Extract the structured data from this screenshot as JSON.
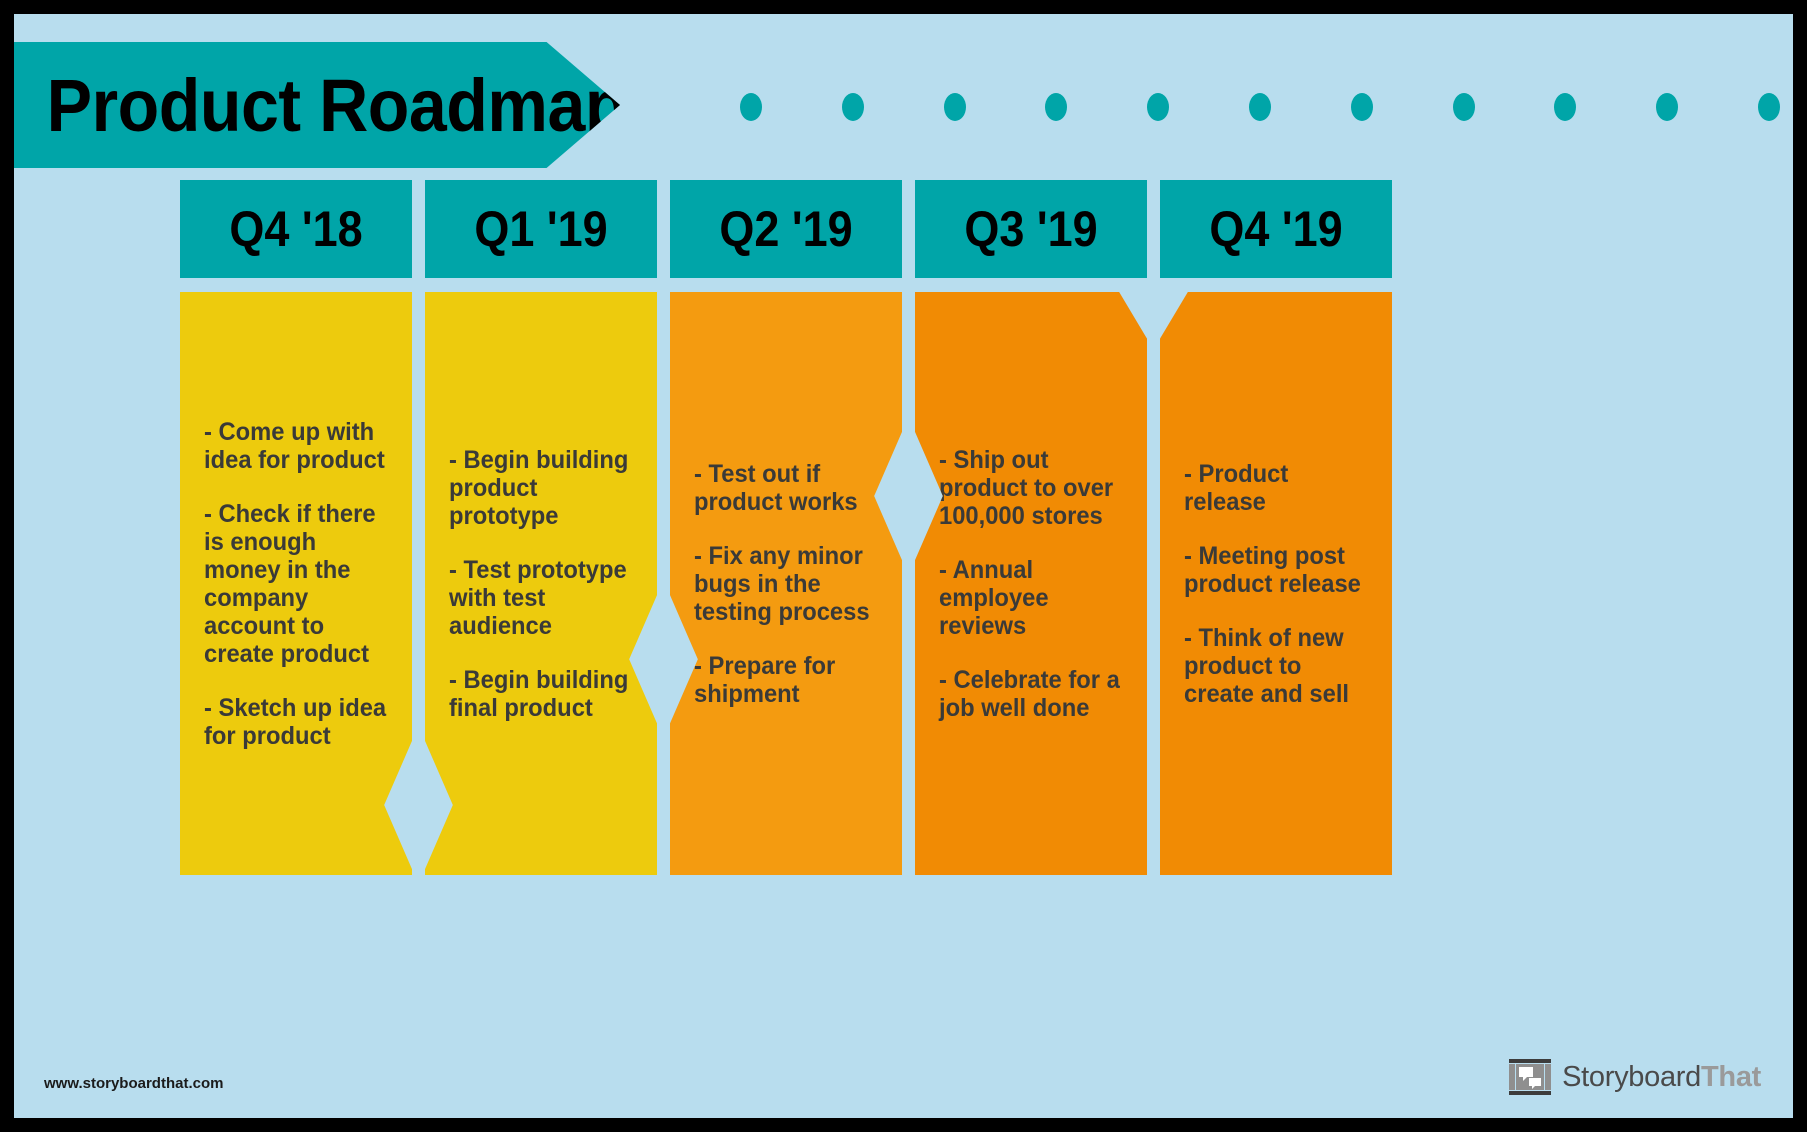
{
  "poster": {
    "title": "Product Roadmap",
    "background_color": "#b8ddee",
    "frame_color": "#000000",
    "accent_teal": "#00a5a8",
    "yellow": "#edcb0d",
    "orange_light": "#f49b10",
    "orange_dark": "#f18b04",
    "text_color": "#3a3a38"
  },
  "decoration": {
    "dot_count": 11,
    "dot_color": "#00a5a8"
  },
  "timeline": {
    "columns": [
      {
        "header": "Q4 '18",
        "color": "#edcb0d",
        "bullets": [
          "- Come up with idea for product",
          "- Check if there is enough money in the company account to create product",
          "- Sketch up idea for product"
        ]
      },
      {
        "header": "Q1 '19",
        "color": "#edcb0d",
        "bullets": [
          "- Begin building product prototype",
          "- Test prototype with test audience",
          "- Begin building final product"
        ]
      },
      {
        "header": "Q2 '19",
        "color": "#f49b10",
        "bullets": [
          "- Test out if product works",
          "- Fix any minor bugs in the testing process",
          "- Prepare for shipment"
        ]
      },
      {
        "header": "Q3 '19",
        "color": "#f18b04",
        "bullets": [
          "- Ship out product to over 100,000 stores",
          "- Annual employee reviews",
          "- Celebrate for a job well done"
        ]
      },
      {
        "header": "Q4 '19",
        "color": "#f18b04",
        "bullets": [
          "- Product release",
          "- Meeting post product release",
          "- Think of new product to create and sell"
        ]
      }
    ]
  },
  "footer": {
    "url": "www.storyboardthat.com",
    "brand_first": "Storyboard",
    "brand_second": "That"
  }
}
